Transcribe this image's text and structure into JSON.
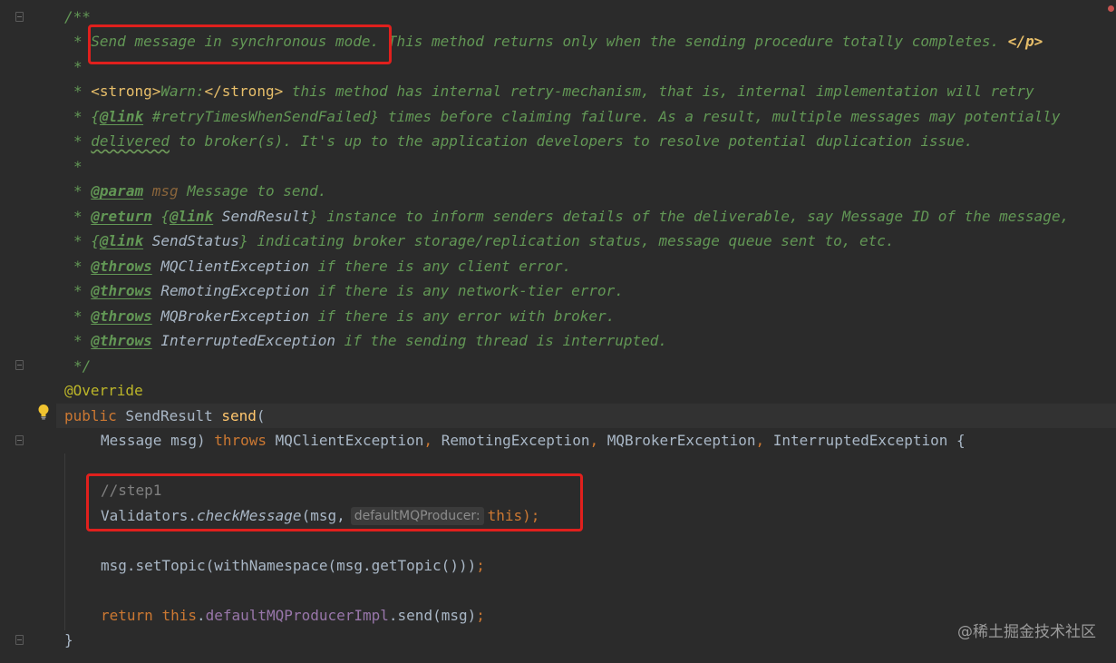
{
  "colors": {
    "background": "#2b2b2b",
    "doc_comment": "#629755",
    "keyword": "#cc7832",
    "annotation": "#bbb529",
    "method_decl": "#ffc66d",
    "field": "#9876aa",
    "line_comment": "#808080",
    "highlight_box": "#e0201d"
  },
  "icons": {
    "intention": "lightbulb-icon",
    "fold": "fold-marker-icon",
    "error": "error-stripe-icon"
  },
  "doc": {
    "open": "/**",
    "star": "*",
    "close": "*/",
    "line1": {
      "a": "Send message in synchronous mode.",
      "b": " This method returns only when the sending procedure totally completes. ",
      "p_close": "</p>"
    },
    "line3": {
      "strong_open": "<strong>",
      "warn": "Warn:",
      "strong_close": "</strong>",
      "rest": " this method has internal retry-mechanism, that is, internal implementation will retry"
    },
    "line4": {
      "open": "{",
      "tag": "@link",
      "ref": " #retryTimesWhenSendFailed",
      "close": "}",
      "rest": " times before claiming failure. As a result, multiple messages may potentially"
    },
    "line5": {
      "word": "delivered",
      "rest": " to broker(s). It's up to the application developers to resolve potential duplication issue."
    },
    "line7": {
      "tag": "@param",
      "param": " msg",
      "rest": " Message to send."
    },
    "line8": {
      "tag": "@return",
      "sp": " ",
      "open": "{",
      "link": "@link",
      "ref": " SendResult",
      "close": "}",
      "rest": " instance to inform senders details of the deliverable, say Message ID of the message,"
    },
    "line9": {
      "open": "{",
      "link": "@link",
      "ref": " SendStatus",
      "close": "}",
      "rest": " indicating broker storage/replication status, message queue sent to, etc."
    },
    "throws": [
      {
        "tag": "@throws",
        "ex": " MQClientException",
        "rest": " if there is any client error."
      },
      {
        "tag": "@throws",
        "ex": " RemotingException",
        "rest": " if there is any network-tier error."
      },
      {
        "tag": "@throws",
        "ex": " MQBrokerException",
        "rest": " if there is any error with broker."
      },
      {
        "tag": "@throws",
        "ex": " InterruptedException",
        "rest": " if the sending thread is interrupted."
      }
    ]
  },
  "code": {
    "annotation": "@Override",
    "sig1": {
      "public": "public",
      "type": " SendResult ",
      "name": "send",
      "paren": "("
    },
    "sig2": {
      "params": "Message msg) ",
      "throws": "throws",
      "e1": " MQClientException",
      "c1": ",",
      "e2": " RemotingException",
      "c2": ",",
      "e3": " MQBrokerException",
      "c3": ",",
      "e4": " InterruptedException",
      "brace": " {"
    },
    "step_comment": "//step1",
    "validate": {
      "cls": "Validators.",
      "method": "checkMessage",
      "args": "(msg,",
      "hint": "defaultMQProducer:",
      "this": "this",
      "end": ");"
    },
    "set_topic": {
      "text": "msg.setTopic(withNamespace(msg.getTopic()))",
      "semi": ";"
    },
    "ret": {
      "return": "return",
      "sp": " ",
      "this": "this",
      "dot": ".",
      "field": "defaultMQProducerImpl",
      "call": ".send(msg)",
      "semi": ";"
    },
    "close_brace": "}"
  },
  "watermark": "@稀土掘金技术社区"
}
